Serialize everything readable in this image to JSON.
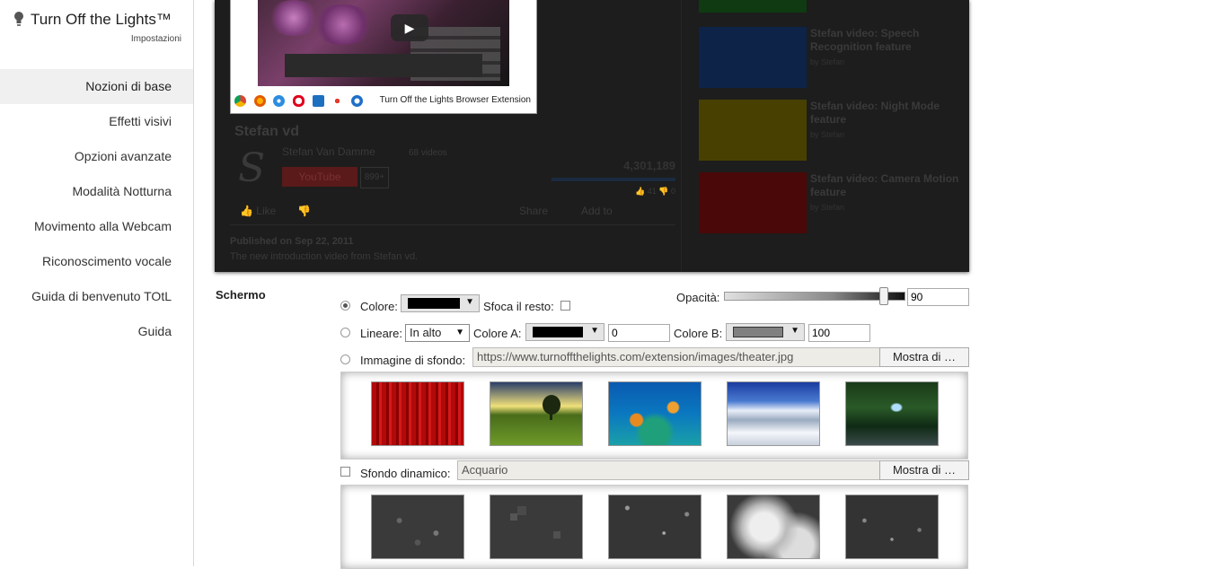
{
  "app": {
    "title": "Turn Off the Lights™",
    "subtitle": "Impostazioni"
  },
  "nav": {
    "items": [
      {
        "label": "Nozioni di base",
        "active": true
      },
      {
        "label": "Effetti visivi"
      },
      {
        "label": "Opzioni avanzate"
      },
      {
        "label": "Modalità Notturna"
      },
      {
        "label": "Movimento alla Webcam"
      },
      {
        "label": "Riconoscimento vocale"
      },
      {
        "label": "Guida di benvenuto TOtL"
      },
      {
        "label": "Guida"
      }
    ]
  },
  "preview": {
    "video_footer_label": "Turn Off the Lights Browser Extension",
    "play_icon": "▶",
    "channel_name": "Stefan vd",
    "channel_logo": "S",
    "channel_owner": "Stefan Van Damme",
    "video_count": "68 videos",
    "youtube_label": "YouTube",
    "subscriber_count": "899+",
    "view_count": "4,301,189",
    "likes_mini": "👍 41  👎 0",
    "like_label": "Like",
    "share_label": "Share",
    "add_to_label": "Add to",
    "published": "Published on Sep 22, 2011",
    "description": "The new introduction video from Stefan vd.",
    "related": [
      {
        "title": "",
        "by": "",
        "color": "#0f3a12"
      },
      {
        "title": "Stefan video: Speech Recognition feature",
        "by": "by Stefan",
        "color": "#0d2448"
      },
      {
        "title": "Stefan video: Night Mode feature",
        "by": "by Stefan",
        "color": "#474000"
      },
      {
        "title": "Stefan video: Camera Motion feature",
        "by": "by Stefan",
        "color": "#4a0808"
      }
    ]
  },
  "settings": {
    "section_label": "Schermo",
    "opacity_label": "Opacità:",
    "opacity_value": "90",
    "opacity_level": 0.9,
    "color_label": "Colore:",
    "color_value": "#000000",
    "blur_label": "Sfoca il resto:",
    "linear_label": "Lineare:",
    "linear_direction": "In alto",
    "color_a_label": "Colore A:",
    "color_a_value": "#000000",
    "color_a_opacity": "0",
    "color_b_label": "Colore B:",
    "color_b_value": "#808080",
    "color_b_opacity": "100",
    "bg_image_label": "Immagine di sfondo:",
    "bg_image_url": "https://www.turnoffthelights.com/extension/images/theater.jpg",
    "show_more_label": "Mostra di …",
    "dynamic_label": "Sfondo dinamico:",
    "dynamic_value": "Acquario",
    "show_more_label_2": "Mostra di …"
  }
}
